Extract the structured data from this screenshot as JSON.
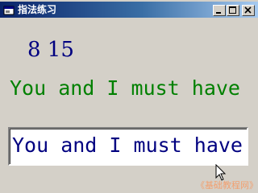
{
  "window": {
    "title": "指法练习",
    "icon": "window-app-icon",
    "buttons": {
      "minimize": "minimize-icon",
      "maximize": "maximize-icon",
      "close": "close-icon"
    }
  },
  "content": {
    "numbers_label": "8 15",
    "sentence_label": "You and I must have",
    "input_value": "You and I must have"
  },
  "watermark": "《基础教程网》",
  "colors": {
    "title_gradient_start": "#0a246a",
    "title_gradient_end": "#a6caf0",
    "numbers_text": "#000080",
    "sentence_text": "#008000",
    "input_text": "#000080",
    "window_bg": "#d4d0c8",
    "watermark": "#f2a070"
  }
}
